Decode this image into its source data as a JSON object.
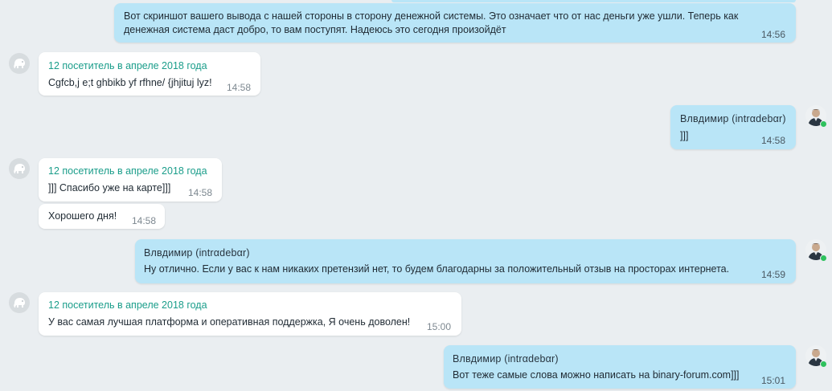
{
  "colors": {
    "outgoing_bubble": "#b9e5f7",
    "incoming_bubble": "#ffffff",
    "visitor_name": "#1a9d8a",
    "online": "#2ec15d",
    "background": "#eaeef1"
  },
  "icons": {
    "visitor_avatar": "elephant-icon",
    "agent_avatar": "user-photo",
    "presence": "online-dot"
  },
  "messages": [
    {
      "direction": "out",
      "sender": "",
      "text": "Вот скриншот вашего вывода с нашей стороны в сторону денежной системы. Это означает что от нас деньги уже ушли. Теперь как денежная система даст добро, то вам поступят. Надеюсь это сегодня произойдёт",
      "time": "14:56"
    },
    {
      "direction": "in",
      "sender": "12 посетитель в апреле 2018 года",
      "text": "Cgfcb,j e;t ghbikb yf rfhne/ {jhjituj lyz!",
      "time": "14:58"
    },
    {
      "direction": "out",
      "sender": "Влвдимир (intrαdebαr)",
      "text": "]]]",
      "time": "14:58"
    },
    {
      "direction": "in",
      "sender": "12 посетитель в апреле 2018 года",
      "text": "]]] Спасибо уже на карте]]]",
      "time": "14:58"
    },
    {
      "direction": "in",
      "sender": "",
      "text": "Хорошего дня!",
      "time": "14:58"
    },
    {
      "direction": "out",
      "sender": "Влвдимир (intrαdebαr)",
      "text": "Ну отлично. Если у вас к нам никаких претензий нет, то будем благодарны за положительный отзыв на просторах интернета.",
      "time": "14:59"
    },
    {
      "direction": "in",
      "sender": "12 посетитель в апреле 2018 года",
      "text": "У вас самая лучшая платформа и оперативная поддержка, Я очень доволен!",
      "time": "15:00"
    },
    {
      "direction": "out",
      "sender": "Влвдимир (intrαdebαr)",
      "text": "Вот теже самые слова можно написать на binary-forum.com]]]",
      "time": "15:01"
    }
  ]
}
